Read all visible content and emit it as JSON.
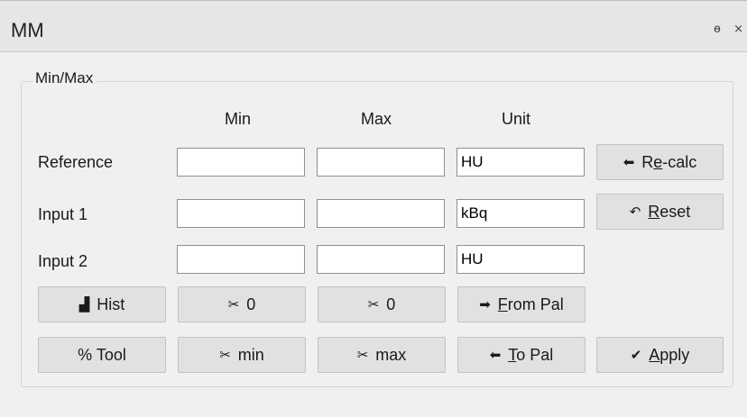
{
  "window": {
    "title": "MM",
    "icons": [
      "restore-icon",
      "close-icon"
    ],
    "restore_glyph": "ѳ",
    "close_glyph": "×"
  },
  "group": {
    "title": "Min/Max"
  },
  "columns": {
    "min": "Min",
    "max": "Max",
    "unit": "Unit"
  },
  "rows": {
    "reference": {
      "label": "Reference",
      "min": "",
      "max": "",
      "unit": "HU"
    },
    "input1": {
      "label": "Input 1",
      "min": "",
      "max": "",
      "unit": "kBq"
    },
    "input2": {
      "label": "Input 2",
      "min": "",
      "max": "",
      "unit": "HU"
    }
  },
  "buttons": {
    "recalc": {
      "icon": "left-arrow-icon",
      "glyph": "⬅",
      "label_pre": "R",
      "label_u": "e",
      "label_post": "-calc"
    },
    "reset": {
      "icon": "undo-arrow-icon",
      "glyph": "↶",
      "label_pre": "",
      "label_u": "R",
      "label_post": "eset"
    },
    "hist": {
      "icon": "histogram-icon",
      "glyph": "▟",
      "label": "Hist"
    },
    "min_zero": {
      "icon": "cut-icon",
      "glyph": "✂",
      "label": "0"
    },
    "max_zero": {
      "icon": "cut-icon",
      "glyph": "✂",
      "label": "0"
    },
    "from_pal": {
      "icon": "double-right-arrow-icon",
      "glyph": "➡",
      "label_pre": "",
      "label_u": "F",
      "label_post": "rom Pal"
    },
    "tool": {
      "label": "% Tool"
    },
    "cut_min": {
      "icon": "cut-icon",
      "glyph": "✂",
      "label": "min"
    },
    "cut_max": {
      "icon": "cut-icon",
      "glyph": "✂",
      "label": "max"
    },
    "to_pal": {
      "icon": "double-left-arrow-icon",
      "glyph": "⬅",
      "label_pre": "",
      "label_u": "T",
      "label_post": "o Pal"
    },
    "apply": {
      "icon": "checkmark-icon",
      "glyph": "✔",
      "label_pre": "",
      "label_u": "A",
      "label_post": "pply"
    }
  }
}
